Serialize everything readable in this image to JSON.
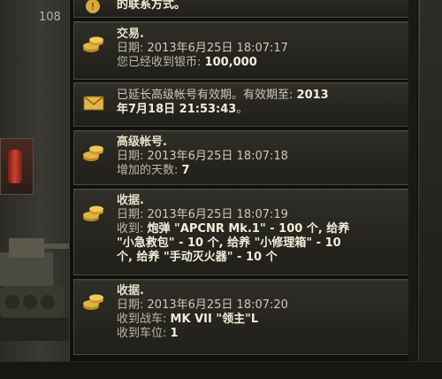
{
  "background": {
    "top_counter": "108"
  },
  "notifications": [
    {
      "icon": "warning-icon",
      "lines": [
        {
          "label": "",
          "value": "的联系方式。"
        }
      ]
    },
    {
      "icon": "silver-coins-icon",
      "title": "交易.",
      "date_label": "日期:",
      "date": "2013年6月25日 18:07:17",
      "body_label": "您已经收到银币:",
      "body_value": "100,000"
    },
    {
      "icon": "envelope-icon",
      "text_prefix": "已延长高级帐号有效期。有效期至:",
      "text_value_1": "2013",
      "text_value_2": "年7月18日 21:53:43",
      "text_suffix": "。"
    },
    {
      "icon": "silver-coins-icon",
      "title": "高级帐号.",
      "date_label": "日期:",
      "date": "2013年6月25日 18:07:18",
      "body_label": "增加的天数:",
      "body_value": "7"
    },
    {
      "icon": "silver-coins-icon",
      "title": "收据.",
      "date_label": "日期:",
      "date": "2013年6月25日 18:07:19",
      "body_label": "收到:",
      "body_value_1": "炮弹 \"APCNR Mk.1\" - 100 个, 给养",
      "body_value_2": "\"小急救包\" - 10 个, 给养 \"小修理箱\" - 10",
      "body_value_3": "个, 给养 \"手动灭火器\" - 10 个"
    },
    {
      "icon": "silver-coins-icon",
      "title": "收据.",
      "date_label": "日期:",
      "date": "2013年6月25日 18:07:20",
      "body_label": "收到战车:",
      "body_value": "MK VII \"领主\"L",
      "body_label_2": "收到车位:",
      "body_value_2": "1"
    }
  ],
  "colors": {
    "panel_bg": "#100f0c",
    "card_bg": "#2a2923",
    "text": "#cfcab8",
    "title": "#e6e0c8",
    "highlight": "#f3eed8",
    "gold": "#d9a93a"
  }
}
